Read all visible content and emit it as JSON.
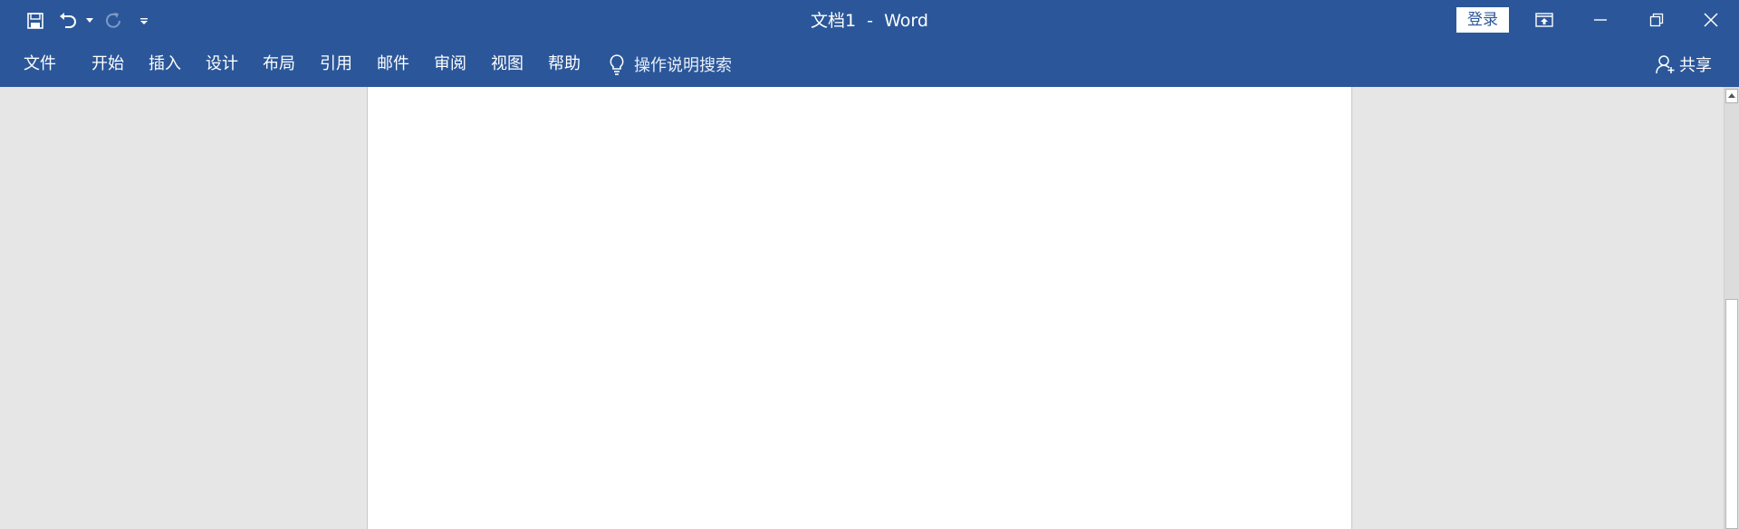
{
  "window": {
    "title": "文档1  -  Word",
    "login_label": "登录"
  },
  "quick_access": {
    "icons": [
      "save-icon",
      "undo-icon",
      "redo-icon",
      "customize-qat-icon"
    ]
  },
  "ribbon": {
    "tabs": [
      {
        "id": "file",
        "label": "文件"
      },
      {
        "id": "home",
        "label": "开始"
      },
      {
        "id": "insert",
        "label": "插入"
      },
      {
        "id": "design",
        "label": "设计"
      },
      {
        "id": "layout",
        "label": "布局"
      },
      {
        "id": "references",
        "label": "引用"
      },
      {
        "id": "mailings",
        "label": "邮件"
      },
      {
        "id": "review",
        "label": "审阅"
      },
      {
        "id": "view",
        "label": "视图"
      },
      {
        "id": "help",
        "label": "帮助"
      }
    ],
    "tell_me": "操作说明搜索",
    "share_label": "共享"
  },
  "colors": {
    "accent": "#2b579a",
    "workspace": "#e6e6e6",
    "page": "#ffffff"
  }
}
